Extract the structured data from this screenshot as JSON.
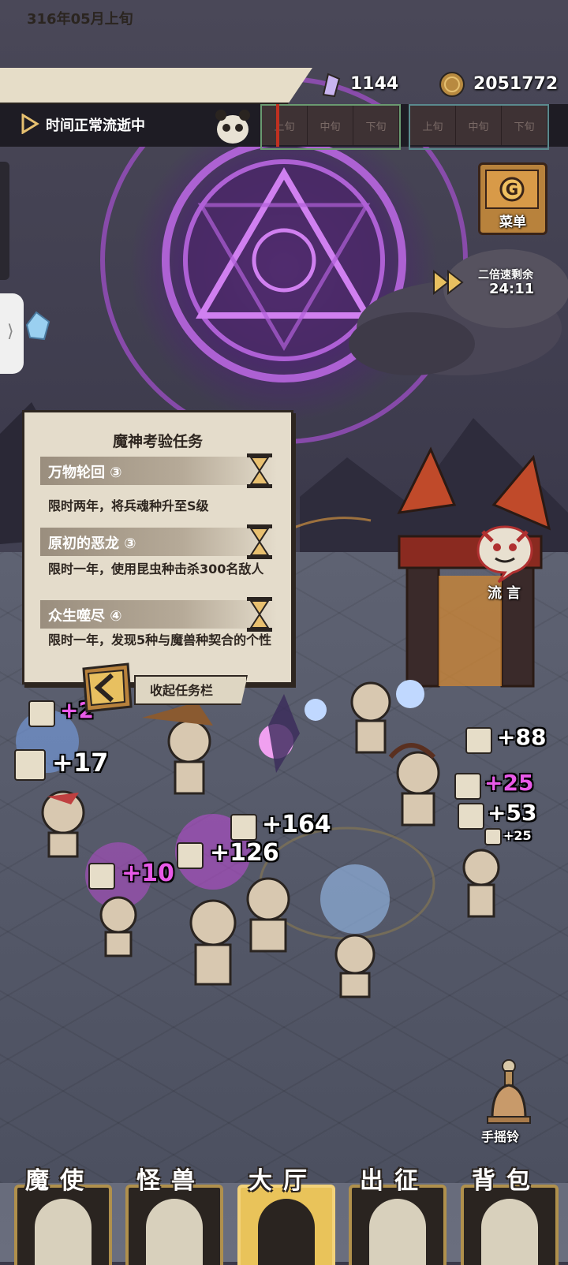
{
  "top": {
    "date": "316年05月上旬",
    "crystals": "1144",
    "coins": "2051772",
    "time_status": "时间正常流逝中",
    "timeline_group1": [
      "上旬",
      "中旬",
      "下旬"
    ],
    "timeline_group2": [
      "上旬",
      "中旬",
      "下旬"
    ]
  },
  "menu": {
    "label": "菜单"
  },
  "speed": {
    "label": "二倍速剩余",
    "time": "24:11"
  },
  "quests": {
    "title": "魔神考验任务",
    "items": [
      {
        "name": "万物轮回 ③",
        "desc": "限时两年，将兵魂种升至S级"
      },
      {
        "name": "原初的恶龙 ③",
        "desc": "限时一年，使用昆虫种击杀300名敌人"
      },
      {
        "name": "众生噬尽 ④",
        "desc": "限时一年，发现5种与魔兽种契合的个性"
      }
    ],
    "collapse": "收起任务栏"
  },
  "rumor": {
    "label": "流言"
  },
  "floats": {
    "f1": "+2",
    "f2": "+17",
    "f3": "+88",
    "f4": "+25",
    "f5": "+53",
    "f6": "+25",
    "f7": "+164",
    "f8": "+126",
    "f9": "+10"
  },
  "bell": {
    "label": "手摇铃"
  },
  "nav": [
    {
      "label": "魔使"
    },
    {
      "label": "怪兽"
    },
    {
      "label": "大厅"
    },
    {
      "label": "出征"
    },
    {
      "label": "背包"
    }
  ],
  "colors": {
    "accent_pink": "#e85ae8",
    "panel": "#e4dccb",
    "nav_active": "#e9c35a"
  }
}
